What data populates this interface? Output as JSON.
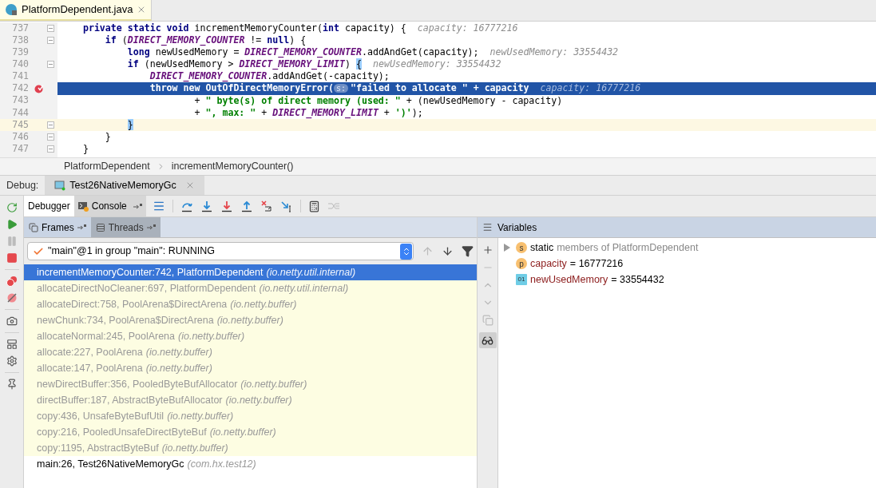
{
  "editor_tab": {
    "title": "PlatformDependent.java",
    "selected": true
  },
  "code_lines": [
    {
      "number": "737",
      "fold": true,
      "selected": false,
      "caret_line": false,
      "breakpoint": false,
      "tokens": [
        {
          "kind": "kw",
          "text": "    private static void"
        },
        {
          "kind": "plain",
          "text": " incrementMemoryCounter("
        },
        {
          "kind": "kw",
          "text": "int"
        },
        {
          "kind": "plain",
          "text": " capacity) {"
        },
        {
          "kind": "hint",
          "text": "capacity: 16777216"
        }
      ]
    },
    {
      "number": "738",
      "fold": true,
      "selected": false,
      "caret_line": false,
      "breakpoint": false,
      "tokens": [
        {
          "kind": "kw",
          "text": "        if"
        },
        {
          "kind": "plain",
          "text": " ("
        },
        {
          "kind": "const",
          "text": "DIRECT_MEMORY_COUNTER"
        },
        {
          "kind": "plain",
          "text": " != "
        },
        {
          "kind": "kw",
          "text": "null"
        },
        {
          "kind": "plain",
          "text": ") {"
        }
      ]
    },
    {
      "number": "739",
      "fold": false,
      "selected": false,
      "caret_line": false,
      "breakpoint": false,
      "tokens": [
        {
          "kind": "kw",
          "text": "            long"
        },
        {
          "kind": "plain",
          "text": " newUsedMemory = "
        },
        {
          "kind": "const",
          "text": "DIRECT_MEMORY_COUNTER"
        },
        {
          "kind": "plain",
          "text": ".addAndGet(capacity);"
        },
        {
          "kind": "hint",
          "text": "newUsedMemory: 33554432"
        }
      ]
    },
    {
      "number": "740",
      "fold": true,
      "selected": false,
      "caret_line": false,
      "breakpoint": false,
      "tokens": [
        {
          "kind": "kw",
          "text": "            if"
        },
        {
          "kind": "plain",
          "text": " (newUsedMemory > "
        },
        {
          "kind": "const",
          "text": "DIRECT_MEMORY_LIMIT"
        },
        {
          "kind": "plain",
          "text": ") "
        },
        {
          "kind": "brace",
          "text": "{"
        },
        {
          "kind": "hint",
          "text": "newUsedMemory: 33554432"
        }
      ]
    },
    {
      "number": "741",
      "fold": false,
      "selected": false,
      "caret_line": false,
      "breakpoint": false,
      "tokens": [
        {
          "kind": "const",
          "text": "                DIRECT_MEMORY_COUNTER"
        },
        {
          "kind": "plain",
          "text": ".addAndGet(-capacity);"
        }
      ]
    },
    {
      "number": "742",
      "fold": false,
      "selected": true,
      "caret_line": false,
      "breakpoint": true,
      "tokens": [
        {
          "kind": "kw",
          "text": "                throw new"
        },
        {
          "kind": "plain",
          "text": " OutOfDirectMemoryError("
        },
        {
          "kind": "param",
          "text": "s:"
        },
        {
          "kind": "str",
          "text": "\"failed to allocate \""
        },
        {
          "kind": "plain",
          "text": " + capacity"
        },
        {
          "kind": "hint",
          "text": "capacity: 16777216"
        }
      ]
    },
    {
      "number": "743",
      "fold": false,
      "selected": false,
      "caret_line": false,
      "breakpoint": false,
      "tokens": [
        {
          "kind": "plain",
          "text": "                        + "
        },
        {
          "kind": "str",
          "text": "\" byte(s) of direct memory (used: \""
        },
        {
          "kind": "plain",
          "text": " + (newUsedMemory - capacity)"
        }
      ]
    },
    {
      "number": "744",
      "fold": false,
      "selected": false,
      "caret_line": false,
      "breakpoint": false,
      "tokens": [
        {
          "kind": "plain",
          "text": "                        + "
        },
        {
          "kind": "str",
          "text": "\", max: \""
        },
        {
          "kind": "plain",
          "text": " + "
        },
        {
          "kind": "const",
          "text": "DIRECT_MEMORY_LIMIT"
        },
        {
          "kind": "plain",
          "text": " + "
        },
        {
          "kind": "str",
          "text": "')'"
        },
        {
          "kind": "plain",
          "text": ");"
        }
      ]
    },
    {
      "number": "745",
      "fold": true,
      "selected": false,
      "caret_line": true,
      "breakpoint": false,
      "tokens": [
        {
          "kind": "brace",
          "text": "            }"
        }
      ]
    },
    {
      "number": "746",
      "fold": true,
      "selected": false,
      "caret_line": false,
      "breakpoint": false,
      "tokens": [
        {
          "kind": "plain",
          "text": "        }"
        }
      ]
    },
    {
      "number": "747",
      "fold": true,
      "selected": false,
      "caret_line": false,
      "breakpoint": false,
      "tokens": [
        {
          "kind": "plain",
          "text": "    }"
        }
      ]
    }
  ],
  "breadcrumbs": [
    "PlatformDependent",
    "incrementMemoryCounter()"
  ],
  "debug_bar": {
    "label": "Debug:",
    "session": "Test26NativeMemoryGc"
  },
  "debug_tabs": [
    {
      "label": "Debugger",
      "selected": true
    },
    {
      "label": "Console",
      "selected": false
    }
  ],
  "frames_tabs": [
    {
      "label": "Frames",
      "selected": true
    },
    {
      "label": "Threads",
      "selected": false
    }
  ],
  "thread_selector": {
    "value": "\"main\"@1 in group \"main\": RUNNING"
  },
  "frames": [
    {
      "location": "incrementMemoryCounter:742, PlatformDependent",
      "package": "(io.netty.util.internal)",
      "kind": "library",
      "selected": true
    },
    {
      "location": "allocateDirectNoCleaner:697, PlatformDependent",
      "package": "(io.netty.util.internal)",
      "kind": "library",
      "selected": false
    },
    {
      "location": "allocateDirect:758, PoolArena$DirectArena",
      "package": "(io.netty.buffer)",
      "kind": "library",
      "selected": false
    },
    {
      "location": "newChunk:734, PoolArena$DirectArena",
      "package": "(io.netty.buffer)",
      "kind": "library",
      "selected": false
    },
    {
      "location": "allocateNormal:245, PoolArena",
      "package": "(io.netty.buffer)",
      "kind": "library",
      "selected": false
    },
    {
      "location": "allocate:227, PoolArena",
      "package": "(io.netty.buffer)",
      "kind": "library",
      "selected": false
    },
    {
      "location": "allocate:147, PoolArena",
      "package": "(io.netty.buffer)",
      "kind": "library",
      "selected": false
    },
    {
      "location": "newDirectBuffer:356, PooledByteBufAllocator",
      "package": "(io.netty.buffer)",
      "kind": "library",
      "selected": false
    },
    {
      "location": "directBuffer:187, AbstractByteBufAllocator",
      "package": "(io.netty.buffer)",
      "kind": "library",
      "selected": false
    },
    {
      "location": "copy:436, UnsafeByteBufUtil",
      "package": "(io.netty.buffer)",
      "kind": "library",
      "selected": false
    },
    {
      "location": "copy:216, PooledUnsafeDirectByteBuf",
      "package": "(io.netty.buffer)",
      "kind": "library",
      "selected": false
    },
    {
      "location": "copy:1195, AbstractByteBuf",
      "package": "(io.netty.buffer)",
      "kind": "library",
      "selected": false
    },
    {
      "location": "main:26, Test26NativeMemoryGc",
      "package": "(com.hx.test12)",
      "kind": "user",
      "selected": false
    }
  ],
  "variables": {
    "title": "Variables",
    "inline_watches": {
      "on": true
    },
    "items": [
      {
        "kind": "static",
        "badge": "s",
        "name": "static",
        "value": "members of PlatformDependent",
        "expanded": false
      },
      {
        "kind": "param",
        "badge": "p",
        "name": "capacity",
        "value": "= 16777216"
      },
      {
        "kind": "local",
        "badge": "01",
        "name": "newUsedMemory",
        "value": "= 33554432"
      }
    ]
  }
}
